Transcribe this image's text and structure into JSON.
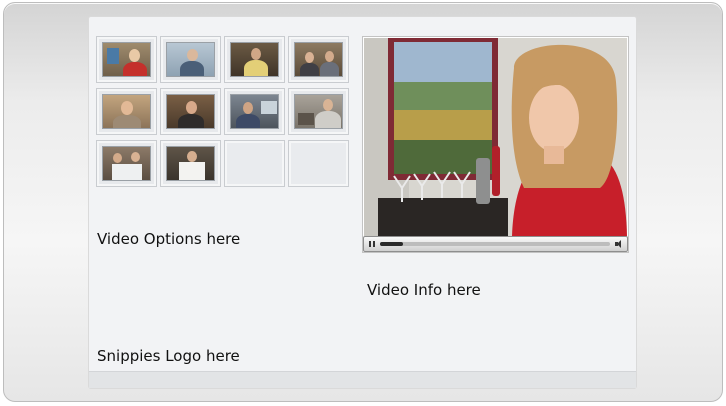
{
  "labels": {
    "video_options": "Video Options here",
    "video_info": "Video Info here",
    "logo": "Snippies Logo here"
  },
  "thumbnails": [
    {
      "id": "thumb-1",
      "filled": true
    },
    {
      "id": "thumb-2",
      "filled": true
    },
    {
      "id": "thumb-3",
      "filled": true
    },
    {
      "id": "thumb-4",
      "filled": true
    },
    {
      "id": "thumb-5",
      "filled": true
    },
    {
      "id": "thumb-6",
      "filled": true
    },
    {
      "id": "thumb-7",
      "filled": true
    },
    {
      "id": "thumb-8",
      "filled": true
    },
    {
      "id": "thumb-9",
      "filled": true
    },
    {
      "id": "thumb-10",
      "filled": true
    },
    {
      "id": "thumb-11",
      "filled": false
    },
    {
      "id": "thumb-12",
      "filled": false
    }
  ],
  "player": {
    "progress": 0.1,
    "controls": [
      "pause-icon",
      "seek-bar",
      "volume-icon"
    ]
  },
  "colors": {
    "panel_bg": "#f2f3f5",
    "frame_bg": "#ececec",
    "text": "#111111"
  }
}
